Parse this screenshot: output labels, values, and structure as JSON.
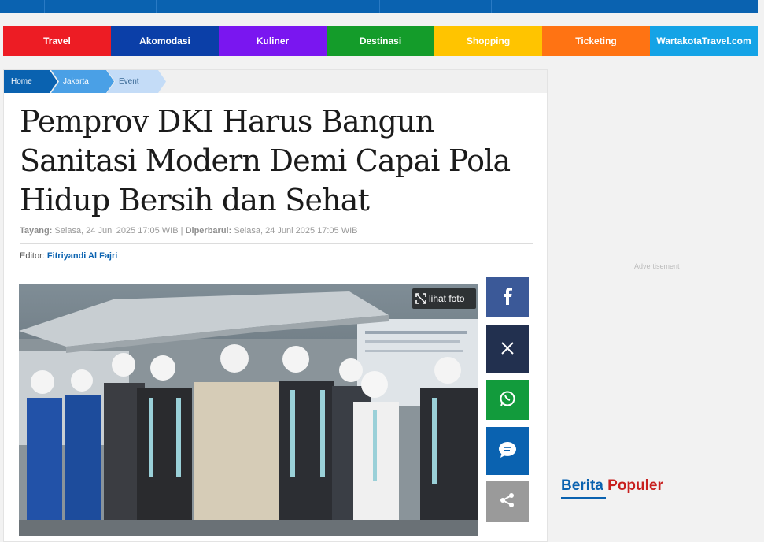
{
  "nav": {
    "categories": [
      {
        "label": "Travel",
        "color": "#ed1c24"
      },
      {
        "label": "Akomodasi",
        "color": "#0b3fa8"
      },
      {
        "label": "Kuliner",
        "color": "#7a16f0"
      },
      {
        "label": "Destinasi",
        "color": "#149c2a"
      },
      {
        "label": "Shopping",
        "color": "#ffc400"
      },
      {
        "label": "Ticketing",
        "color": "#ff7313"
      },
      {
        "label": "WartakotaTravel.com",
        "color": "#14a3e6"
      }
    ]
  },
  "breadcrumb": {
    "home": "Home",
    "section": "Jakarta",
    "sub": "Event"
  },
  "article": {
    "title": "Pemprov DKI Harus Bangun Sanitasi Modern Demi Capai Pola Hidup Bersih dan Sehat",
    "published_label": "Tayang:",
    "published": "Selasa, 24 Juni 2025 17:05 WIB",
    "separator": "|",
    "updated_label": "Diperbarui:",
    "updated": "Selasa, 24 Juni 2025 17:05 WIB",
    "editor_label": "Editor:",
    "editor_name": "Fitriyandi Al Fajri"
  },
  "photo": {
    "view_label": "lihat foto"
  },
  "share": {
    "icons": [
      "facebook-icon",
      "x-icon",
      "whatsapp-icon",
      "comment-icon",
      "share-icon"
    ],
    "colors": [
      "#3b5998",
      "#22304f",
      "#129b3c",
      "#0a62b0",
      "#9a9a9a"
    ]
  },
  "sidebar": {
    "ad_label": "Advertisement",
    "populer_a": "Berita",
    "populer_b": "Populer"
  }
}
